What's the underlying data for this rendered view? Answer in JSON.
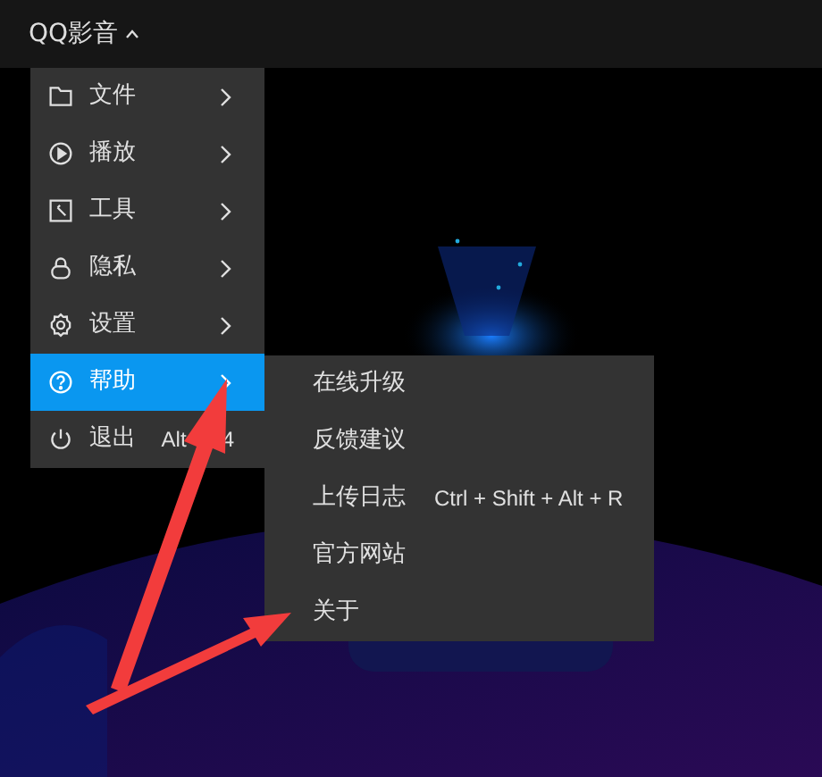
{
  "app_title": "QQ影音",
  "menu": [
    {
      "label": "文件",
      "kind": "folder",
      "has_submenu": true,
      "selected": false
    },
    {
      "label": "播放",
      "kind": "play",
      "has_submenu": true,
      "selected": false
    },
    {
      "label": "工具",
      "kind": "tool",
      "has_submenu": true,
      "selected": false
    },
    {
      "label": "隐私",
      "kind": "lock",
      "has_submenu": true,
      "selected": false
    },
    {
      "label": "设置",
      "kind": "gear",
      "has_submenu": true,
      "selected": false
    },
    {
      "label": "帮助",
      "kind": "help",
      "has_submenu": true,
      "selected": true
    },
    {
      "label": "退出",
      "kind": "power",
      "has_submenu": false,
      "selected": false,
      "shortcut_parts": [
        "Alt",
        "4"
      ]
    }
  ],
  "submenu": [
    {
      "label": "在线升级"
    },
    {
      "label": "反馈建议"
    },
    {
      "label": "上传日志",
      "shortcut": "Ctrl + Shift + Alt + R"
    },
    {
      "label": "官方网站"
    },
    {
      "label": "关于"
    }
  ]
}
